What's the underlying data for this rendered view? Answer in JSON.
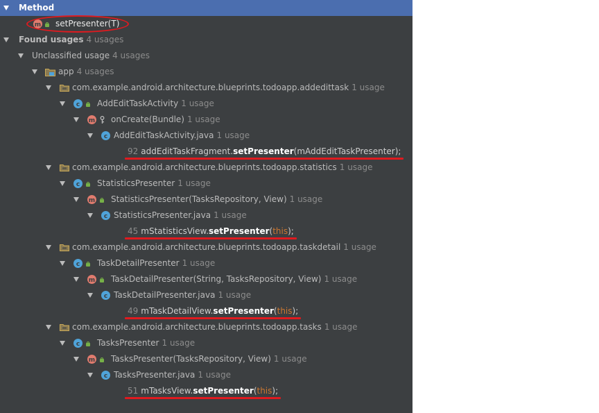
{
  "header": {
    "label": "Method"
  },
  "target": {
    "icon": "method-m-icon",
    "label": "setPresenter(T)"
  },
  "found": {
    "label": "Found usages",
    "count": "4 usages"
  },
  "unclassified": {
    "label": "Unclassified usage",
    "count": "4 usages"
  },
  "app": {
    "label": "app",
    "count": "4 usages"
  },
  "groups": [
    {
      "package": "com.example.android.architecture.blueprints.todoapp.addedittask",
      "package_count": "1 usage",
      "class": "AddEditTaskActivity",
      "class_count": "1 usage",
      "method": "onCreate(Bundle)",
      "method_count": "1 usage",
      "file": "AddEditTaskActivity.java",
      "file_count": "1 usage",
      "line": "92",
      "call_prefix": "addEditTaskFragment.",
      "call_method": "setPresenter",
      "call_args": "(mAddEditTaskPresenter);"
    },
    {
      "package": "com.example.android.architecture.blueprints.todoapp.statistics",
      "package_count": "1 usage",
      "class": "StatisticsPresenter",
      "class_count": "1 usage",
      "method": "StatisticsPresenter(TasksRepository, View)",
      "method_count": "1 usage",
      "file": "StatisticsPresenter.java",
      "file_count": "1 usage",
      "line": "45",
      "call_prefix": "mStatisticsView.",
      "call_method": "setPresenter",
      "call_open": "(",
      "call_kw": "this",
      "call_close": ");"
    },
    {
      "package": "com.example.android.architecture.blueprints.todoapp.taskdetail",
      "package_count": "1 usage",
      "class": "TaskDetailPresenter",
      "class_count": "1 usage",
      "method": "TaskDetailPresenter(String, TasksRepository, View)",
      "method_count": "1 usage",
      "file": "TaskDetailPresenter.java",
      "file_count": "1 usage",
      "line": "49",
      "call_prefix": "mTaskDetailView.",
      "call_method": "setPresenter",
      "call_open": "(",
      "call_kw": "this",
      "call_close": ");"
    },
    {
      "package": "com.example.android.architecture.blueprints.todoapp.tasks",
      "package_count": "1 usage",
      "class": "TasksPresenter",
      "class_count": "1 usage",
      "method": "TasksPresenter(TasksRepository, View)",
      "method_count": "1 usage",
      "file": "TasksPresenter.java",
      "file_count": "1 usage",
      "line": "51",
      "call_prefix": "mTasksView.",
      "call_method": "setPresenter",
      "call_open": "(",
      "call_kw": "this",
      "call_close": ");"
    }
  ],
  "colors": {
    "panel_bg": "#3c3f41",
    "selection": "#4b6eaf",
    "annotation_red": "#e01a1f",
    "keyword": "#cc7832",
    "class_icon": "#4fa3d9",
    "method_icon": "#e07b6e"
  }
}
